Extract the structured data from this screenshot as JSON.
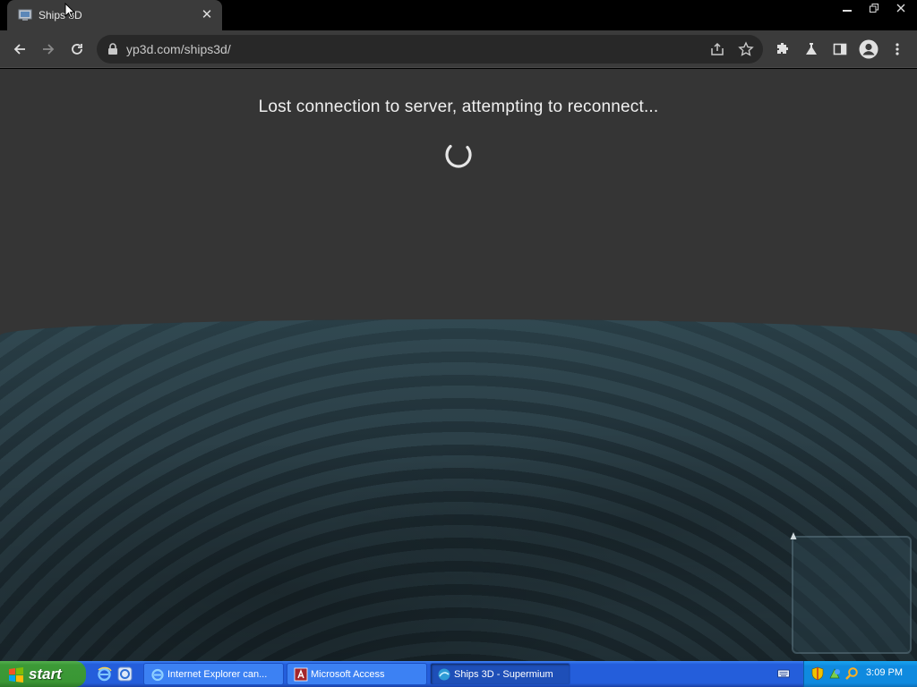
{
  "browser": {
    "tab": {
      "title": "Ships 3D",
      "favicon": "monitor-icon"
    },
    "address_bar": {
      "url": "yp3d.com/ships3d/"
    },
    "window_controls": [
      "minimize",
      "restore",
      "close"
    ]
  },
  "page": {
    "status_message": "Lost connection to server, attempting to reconnect...",
    "minimap_marker": "A"
  },
  "taskbar": {
    "start_label": "start",
    "tasks": [
      {
        "label": "Internet Explorer can...",
        "icon": "ie-icon",
        "active": false
      },
      {
        "label": "Microsoft Access",
        "icon": "access-icon",
        "active": false
      },
      {
        "label": "Ships 3D - Supermium",
        "icon": "supermium-icon",
        "active": true
      }
    ],
    "clock": "3:09 PM"
  },
  "colors": {
    "browser_chrome": "#3b3b3b",
    "omnibox": "#282828",
    "page_bg": "#353535",
    "sea": "#2b3f47",
    "taskbar": "#245edb",
    "start_button": "#3c9a37",
    "tray": "#0f8adf"
  }
}
